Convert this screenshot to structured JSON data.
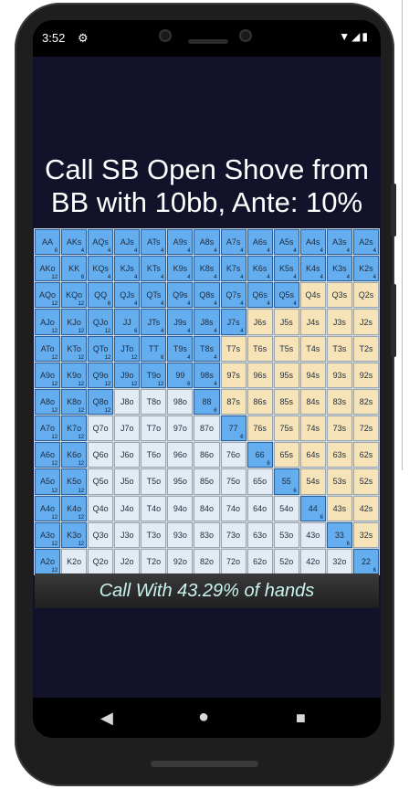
{
  "status": {
    "time": "3:52",
    "icons": "▼◢▮"
  },
  "title": "Call SB Open Shove from BB with 10bb, Ante: 10%",
  "summary": "Call With 43.29% of hands",
  "grid": [
    [
      [
        "AA",
        "6",
        "call"
      ],
      [
        "AKs",
        "4",
        "call"
      ],
      [
        "AQs",
        "4",
        "call"
      ],
      [
        "AJs",
        "4",
        "call"
      ],
      [
        "ATs",
        "4",
        "call"
      ],
      [
        "A9s",
        "4",
        "call"
      ],
      [
        "A8s",
        "4",
        "call"
      ],
      [
        "A7s",
        "4",
        "call"
      ],
      [
        "A6s",
        "4",
        "call"
      ],
      [
        "A5s",
        "4",
        "call"
      ],
      [
        "A4s",
        "4",
        "call"
      ],
      [
        "A3s",
        "4",
        "call"
      ],
      [
        "A2s",
        "4",
        "call"
      ]
    ],
    [
      [
        "AKo",
        "12",
        "call"
      ],
      [
        "KK",
        "6",
        "call"
      ],
      [
        "KQs",
        "4",
        "call"
      ],
      [
        "KJs",
        "4",
        "call"
      ],
      [
        "KTs",
        "4",
        "call"
      ],
      [
        "K9s",
        "4",
        "call"
      ],
      [
        "K8s",
        "4",
        "call"
      ],
      [
        "K7s",
        "4",
        "call"
      ],
      [
        "K6s",
        "4",
        "call"
      ],
      [
        "K5s",
        "4",
        "call"
      ],
      [
        "K4s",
        "4",
        "call"
      ],
      [
        "K3s",
        "4",
        "call"
      ],
      [
        "K2s",
        "4",
        "call"
      ]
    ],
    [
      [
        "AQo",
        "12",
        "call"
      ],
      [
        "KQo",
        "12",
        "call"
      ],
      [
        "QQ",
        "6",
        "call"
      ],
      [
        "QJs",
        "4",
        "call"
      ],
      [
        "QTs",
        "4",
        "call"
      ],
      [
        "Q9s",
        "4",
        "call"
      ],
      [
        "Q8s",
        "4",
        "call"
      ],
      [
        "Q7s",
        "4",
        "call"
      ],
      [
        "Q6s",
        "4",
        "call"
      ],
      [
        "Q5s",
        "4",
        "call"
      ],
      [
        "Q4s",
        "",
        "suited"
      ],
      [
        "Q3s",
        "",
        "suited"
      ],
      [
        "Q2s",
        "",
        "suited"
      ]
    ],
    [
      [
        "AJo",
        "12",
        "call"
      ],
      [
        "KJo",
        "12",
        "call"
      ],
      [
        "QJo",
        "12",
        "call"
      ],
      [
        "JJ",
        "6",
        "call"
      ],
      [
        "JTs",
        "4",
        "call"
      ],
      [
        "J9s",
        "4",
        "call"
      ],
      [
        "J8s",
        "4",
        "call"
      ],
      [
        "J7s",
        "4",
        "call"
      ],
      [
        "J6s",
        "",
        "suited"
      ],
      [
        "J5s",
        "",
        "suited"
      ],
      [
        "J4s",
        "",
        "suited"
      ],
      [
        "J3s",
        "",
        "suited"
      ],
      [
        "J2s",
        "",
        "suited"
      ]
    ],
    [
      [
        "ATo",
        "12",
        "call"
      ],
      [
        "KTo",
        "12",
        "call"
      ],
      [
        "QTo",
        "12",
        "call"
      ],
      [
        "JTo",
        "12",
        "call"
      ],
      [
        "TT",
        "6",
        "call"
      ],
      [
        "T9s",
        "4",
        "call"
      ],
      [
        "T8s",
        "4",
        "call"
      ],
      [
        "T7s",
        "",
        "suited"
      ],
      [
        "T6s",
        "",
        "suited"
      ],
      [
        "T5s",
        "",
        "suited"
      ],
      [
        "T4s",
        "",
        "suited"
      ],
      [
        "T3s",
        "",
        "suited"
      ],
      [
        "T2s",
        "",
        "suited"
      ]
    ],
    [
      [
        "A9o",
        "12",
        "call"
      ],
      [
        "K9o",
        "12",
        "call"
      ],
      [
        "Q9o",
        "12",
        "call"
      ],
      [
        "J9o",
        "12",
        "call"
      ],
      [
        "T9o",
        "12",
        "call"
      ],
      [
        "99",
        "6",
        "call"
      ],
      [
        "98s",
        "4",
        "call"
      ],
      [
        "97s",
        "",
        "suited"
      ],
      [
        "96s",
        "",
        "suited"
      ],
      [
        "95s",
        "",
        "suited"
      ],
      [
        "94s",
        "",
        "suited"
      ],
      [
        "93s",
        "",
        "suited"
      ],
      [
        "92s",
        "",
        "suited"
      ]
    ],
    [
      [
        "A8o",
        "12",
        "call"
      ],
      [
        "K8o",
        "12",
        "call"
      ],
      [
        "Q8o",
        "12",
        "call"
      ],
      [
        "J8o",
        "",
        "fold"
      ],
      [
        "T8o",
        "",
        "fold"
      ],
      [
        "98o",
        "",
        "fold"
      ],
      [
        "88",
        "6",
        "call"
      ],
      [
        "87s",
        "",
        "suited"
      ],
      [
        "86s",
        "",
        "suited"
      ],
      [
        "85s",
        "",
        "suited"
      ],
      [
        "84s",
        "",
        "suited"
      ],
      [
        "83s",
        "",
        "suited"
      ],
      [
        "82s",
        "",
        "suited"
      ]
    ],
    [
      [
        "A7o",
        "12",
        "call"
      ],
      [
        "K7o",
        "12",
        "call"
      ],
      [
        "Q7o",
        "",
        "fold"
      ],
      [
        "J7o",
        "",
        "fold"
      ],
      [
        "T7o",
        "",
        "fold"
      ],
      [
        "97o",
        "",
        "fold"
      ],
      [
        "87o",
        "",
        "fold"
      ],
      [
        "77",
        "6",
        "call"
      ],
      [
        "76s",
        "",
        "suited"
      ],
      [
        "75s",
        "",
        "suited"
      ],
      [
        "74s",
        "",
        "suited"
      ],
      [
        "73s",
        "",
        "suited"
      ],
      [
        "72s",
        "",
        "suited"
      ]
    ],
    [
      [
        "A6o",
        "12",
        "call"
      ],
      [
        "K6o",
        "12",
        "call"
      ],
      [
        "Q6o",
        "",
        "fold"
      ],
      [
        "J6o",
        "",
        "fold"
      ],
      [
        "T6o",
        "",
        "fold"
      ],
      [
        "96o",
        "",
        "fold"
      ],
      [
        "86o",
        "",
        "fold"
      ],
      [
        "76o",
        "",
        "fold"
      ],
      [
        "66",
        "6",
        "call"
      ],
      [
        "65s",
        "",
        "suited"
      ],
      [
        "64s",
        "",
        "suited"
      ],
      [
        "63s",
        "",
        "suited"
      ],
      [
        "62s",
        "",
        "suited"
      ]
    ],
    [
      [
        "A5o",
        "12",
        "call"
      ],
      [
        "K5o",
        "12",
        "call"
      ],
      [
        "Q5o",
        "",
        "fold"
      ],
      [
        "J5o",
        "",
        "fold"
      ],
      [
        "T5o",
        "",
        "fold"
      ],
      [
        "95o",
        "",
        "fold"
      ],
      [
        "85o",
        "",
        "fold"
      ],
      [
        "75o",
        "",
        "fold"
      ],
      [
        "65o",
        "",
        "fold"
      ],
      [
        "55",
        "6",
        "call"
      ],
      [
        "54s",
        "",
        "suited"
      ],
      [
        "53s",
        "",
        "suited"
      ],
      [
        "52s",
        "",
        "suited"
      ]
    ],
    [
      [
        "A4o",
        "12",
        "call"
      ],
      [
        "K4o",
        "12",
        "call"
      ],
      [
        "Q4o",
        "",
        "fold"
      ],
      [
        "J4o",
        "",
        "fold"
      ],
      [
        "T4o",
        "",
        "fold"
      ],
      [
        "94o",
        "",
        "fold"
      ],
      [
        "84o",
        "",
        "fold"
      ],
      [
        "74o",
        "",
        "fold"
      ],
      [
        "64o",
        "",
        "fold"
      ],
      [
        "54o",
        "",
        "fold"
      ],
      [
        "44",
        "6",
        "call"
      ],
      [
        "43s",
        "",
        "suited"
      ],
      [
        "42s",
        "",
        "suited"
      ]
    ],
    [
      [
        "A3o",
        "12",
        "call"
      ],
      [
        "K3o",
        "12",
        "call"
      ],
      [
        "Q3o",
        "",
        "fold"
      ],
      [
        "J3o",
        "",
        "fold"
      ],
      [
        "T3o",
        "",
        "fold"
      ],
      [
        "93o",
        "",
        "fold"
      ],
      [
        "83o",
        "",
        "fold"
      ],
      [
        "73o",
        "",
        "fold"
      ],
      [
        "63o",
        "",
        "fold"
      ],
      [
        "53o",
        "",
        "fold"
      ],
      [
        "43o",
        "",
        "fold"
      ],
      [
        "33",
        "6",
        "call"
      ],
      [
        "32s",
        "",
        "suited"
      ]
    ],
    [
      [
        "A2o",
        "12",
        "call"
      ],
      [
        "K2o",
        "",
        "fold"
      ],
      [
        "Q2o",
        "",
        "fold"
      ],
      [
        "J2o",
        "",
        "fold"
      ],
      [
        "T2o",
        "",
        "fold"
      ],
      [
        "92o",
        "",
        "fold"
      ],
      [
        "82o",
        "",
        "fold"
      ],
      [
        "72o",
        "",
        "fold"
      ],
      [
        "62o",
        "",
        "fold"
      ],
      [
        "52o",
        "",
        "fold"
      ],
      [
        "42o",
        "",
        "fold"
      ],
      [
        "32o",
        "",
        "fold"
      ],
      [
        "22",
        "6",
        "call"
      ]
    ]
  ],
  "nav": {
    "back": "◀",
    "home": "●",
    "recents": "■"
  }
}
